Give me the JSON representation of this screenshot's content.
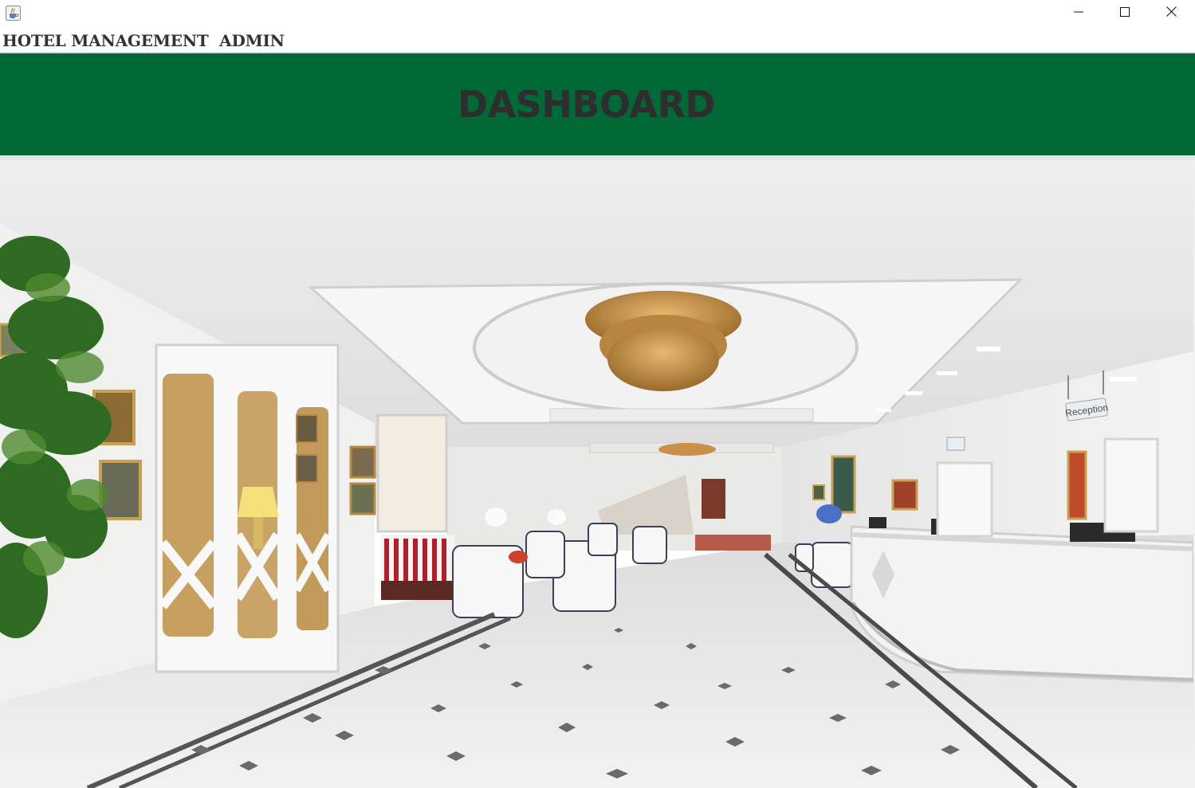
{
  "window": {
    "app_icon": "java-coffee-cup-icon",
    "controls": {
      "minimize_icon": "minimize-icon",
      "maximize_icon": "maximize-icon",
      "close_icon": "close-icon"
    }
  },
  "app_title": "HOTEL MANAGEMENT  ADMIN",
  "header": {
    "title": "DASHBOARD",
    "background_color": "#006936",
    "title_color": "#2e2e2e"
  },
  "lobby_image": {
    "sign_text": "Reception"
  }
}
